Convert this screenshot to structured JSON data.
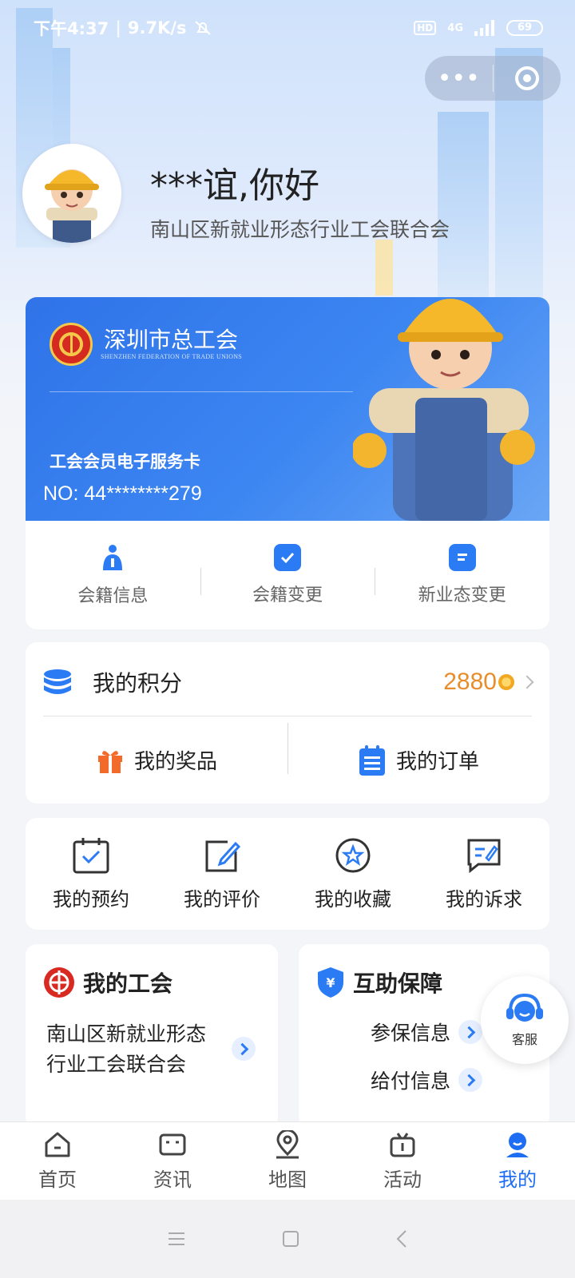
{
  "status_bar": {
    "time": "下午4:37",
    "speed": "9.7K/s",
    "network": "4G",
    "hd": "HD",
    "battery": "69"
  },
  "mini_program": {
    "more_icon": "more-dots-icon",
    "close_icon": "target-close-icon"
  },
  "profile": {
    "greeting": "***谊,你好",
    "union": "南山区新就业形态行业工会联合会"
  },
  "member_card": {
    "org_name": "深圳市总工会",
    "org_name_en": "SHENZHEN FEDERATION OF TRADE UNIONS",
    "card_title": "工会会员电子服务卡",
    "card_no": "NO: 44********279",
    "actions": [
      {
        "label": "会籍信息",
        "icon": "person-info-icon"
      },
      {
        "label": "会籍变更",
        "icon": "check-shield-icon"
      },
      {
        "label": "新业态变更",
        "icon": "document-icon"
      }
    ]
  },
  "points": {
    "label": "我的积分",
    "value": "2880",
    "prizes_label": "我的奖品",
    "orders_label": "我的订单"
  },
  "quick_links": [
    {
      "label": "我的预约",
      "icon": "calendar-check-icon"
    },
    {
      "label": "我的评价",
      "icon": "edit-icon"
    },
    {
      "label": "我的收藏",
      "icon": "star-icon"
    },
    {
      "label": "我的诉求",
      "icon": "message-edit-icon"
    }
  ],
  "my_union": {
    "title": "我的工会",
    "name_line1": "南山区新就业形态",
    "name_line2": "行业工会联合会"
  },
  "mutual_aid": {
    "title": "互助保障",
    "items": [
      "参保信息",
      "给付信息"
    ]
  },
  "customer_service": {
    "label": "客服"
  },
  "tabs": [
    {
      "label": "首页",
      "icon": "home-icon"
    },
    {
      "label": "资讯",
      "icon": "news-icon"
    },
    {
      "label": "地图",
      "icon": "map-pin-icon"
    },
    {
      "label": "活动",
      "icon": "activity-icon"
    },
    {
      "label": "我的",
      "icon": "user-icon",
      "active": true
    }
  ],
  "colors": {
    "accent": "#1d6ef2",
    "points": "#e88d2b",
    "card": "#2f73e8"
  }
}
